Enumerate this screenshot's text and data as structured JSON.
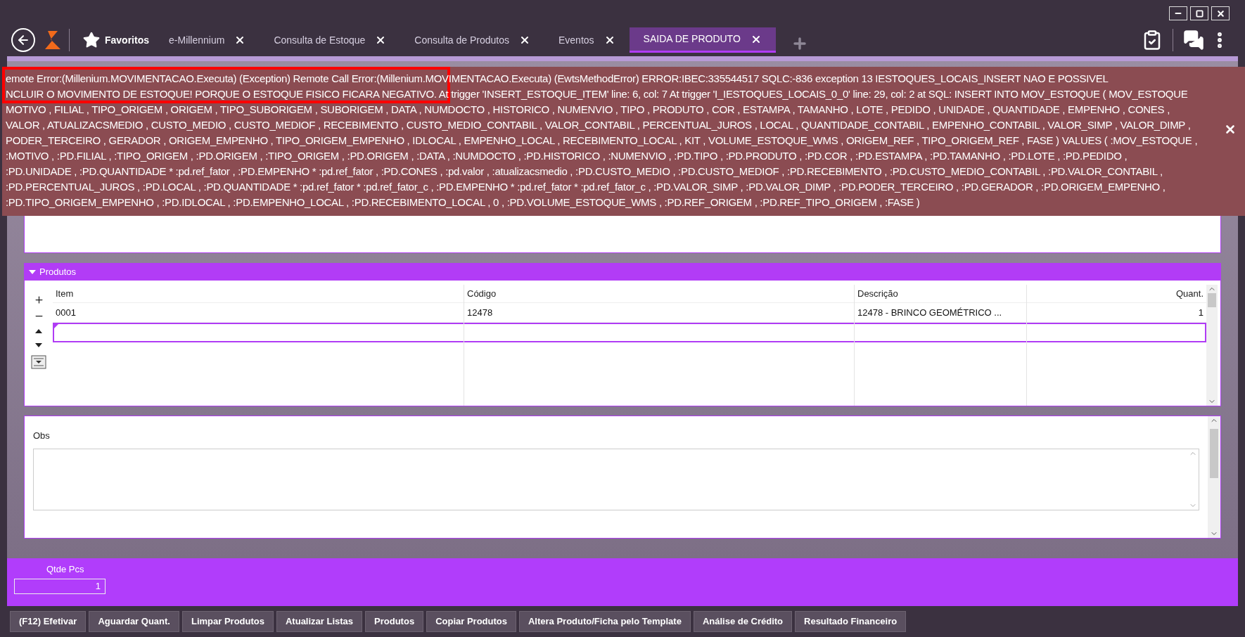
{
  "tabs": [
    {
      "label": "Favoritos",
      "kind": "favorites",
      "selected": false
    },
    {
      "label": "e-Millennium",
      "kind": "tab",
      "selected": false
    },
    {
      "label": "Consulta de Estoque",
      "kind": "tab",
      "selected": false
    },
    {
      "label": "Consulta de Produtos",
      "kind": "tab",
      "selected": false
    },
    {
      "label": "Eventos",
      "kind": "tab",
      "selected": false
    },
    {
      "label": "SAIDA DE PRODUTO",
      "kind": "tab",
      "selected": true
    }
  ],
  "error": {
    "lines": [
      "emote Error:(Millenium.MOVIMENTACAO.Executa) (Exception) Remote Call Error:(Millenium.MOVIMENTACAO.Executa) (EwtsMethodError) ERROR:IBEC:335544517 SQLC:-836 exception 13 IESTOQUES_LOCAIS_INSERT NAO E POSSIVEL",
      "NCLUIR O MOVIMENTO DE ESTOQUE! PORQUE O ESTOQUE FISICO FICARA NEGATIVO. At trigger 'INSERT_ESTOQUE_ITEM' line: 6, col: 7 At trigger 'I_IESTOQUES_LOCAIS_0_0' line: 29, col: 2 at SQL: INSERT INTO MOV_ESTOQUE ( MOV_ESTOQUE",
      "MOTIVO , FILIAL , TIPO_ORIGEM , ORIGEM , TIPO_SUBORIGEM , SUBORIGEM , DATA , NUMDOCTO , HISTORICO , NUMENVIO , TIPO , PRODUTO , COR , ESTAMPA , TAMANHO , LOTE , PEDIDO , UNIDADE , QUANTIDADE , EMPENHO , CONES ,",
      "VALOR , ATUALIZACSMEDIO , CUSTO_MEDIO , CUSTO_MEDIOF , RECEBIMENTO , CUSTO_MEDIO_CONTABIL , VALOR_CONTABIL , PERCENTUAL_JUROS , LOCAL , QUANTIDADE_CONTABIL , EMPENHO_CONTABIL , VALOR_SIMP , VALOR_DIMP ,",
      "PODER_TERCEIRO , GERADOR , ORIGEM_EMPENHO , TIPO_ORIGEM_EMPENHO , IDLOCAL , EMPENHO_LOCAL , RECEBIMENTO_LOCAL , KIT , VOLUME_ESTOQUE_WMS , ORIGEM_REF , TIPO_ORIGEM_REF , FASE ) VALUES ( :MOV_ESTOQUE ,",
      ":MOTIVO , :PD.FILIAL , :TIPO_ORIGEM , :PD.ORIGEM , :TIPO_ORIGEM , :PD.ORIGEM , :DATA , :NUMDOCTO , :PD.HISTORICO , :NUMENVIO , :PD.TIPO , :PD.PRODUTO , :PD.COR , :PD.ESTAMPA , :PD.TAMANHO , :PD.LOTE , :PD.PEDIDO ,",
      ":PD.UNIDADE , :PD.QUANTIDADE * :pd.ref_fator , :PD.EMPENHO * :pd.ref_fator , :PD.CONES , :pd.valor , :atualizacsmedio , :PD.CUSTO_MEDIO , :PD.CUSTO_MEDIOF , :PD.RECEBIMENTO , :PD.CUSTO_MEDIO_CONTABIL , :PD.VALOR_CONTABIL ,",
      ":PD.PERCENTUAL_JUROS , :PD.LOCAL , :PD.QUANTIDADE * :pd.ref_fator * :pd.ref_fator_c , :PD.EMPENHO * :pd.ref_fator * :pd.ref_fator_c , :PD.VALOR_SIMP , :PD.VALOR_DIMP , :PD.PODER_TERCEIRO , :PD.GERADOR , :PD.ORIGEM_EMPENHO ,",
      ":PD.TIPO_ORIGEM_EMPENHO , :PD.IDLOCAL , :PD.EMPENHO_LOCAL , :PD.RECEBIMENTO_LOCAL , 0 , :PD.VOLUME_ESTOQUE_WMS , :PD.REF_ORIGEM , :PD.REF_TIPO_ORIGEM , :FASE )"
    ]
  },
  "products": {
    "title": "Produtos",
    "expanded": true,
    "columns": [
      "Item",
      "Código",
      "Descrição",
      "Quant."
    ],
    "rows": [
      {
        "kind": "item",
        "selected": false,
        "cells": [
          "0001",
          "12478",
          "12478 - BRINCO GEOMÉTRICO ...",
          "1"
        ]
      },
      {
        "kind": "new",
        "selected": true
      }
    ]
  },
  "obs": {
    "label": "Obs"
  },
  "totals": {
    "label": "Qtde Pcs",
    "value": "1"
  },
  "actions": [
    "(F12) Efetivar",
    "Aguardar Quant.",
    "Limpar Produtos",
    "Atualizar Listas",
    "Produtos",
    "Copiar Produtos",
    "Altera Produto/Ficha pelo Template",
    "Análise de Crédito",
    "Resultado Financeiro"
  ]
}
